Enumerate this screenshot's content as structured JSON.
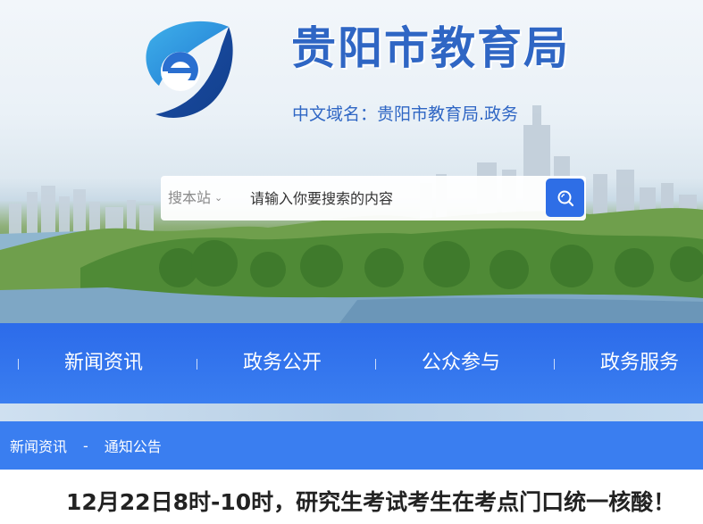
{
  "header": {
    "title": "贵阳市教育局",
    "domain_label": "中文域名：贵阳市教育局.政务",
    "logo_icon": "e-logo-icon"
  },
  "search": {
    "scope": "搜本站",
    "placeholder": "请输入你要搜索的内容",
    "button_icon": "search-icon"
  },
  "nav": {
    "items": [
      {
        "label": "新闻资讯"
      },
      {
        "label": "政务公开"
      },
      {
        "label": "公众参与"
      },
      {
        "label": "政务服务"
      }
    ]
  },
  "breadcrumb": {
    "items": [
      "新闻资讯",
      "通知公告"
    ],
    "separator": "-"
  },
  "article": {
    "title": "12月22日8时-10时，研究生考试考生在考点门口统一核酸！"
  },
  "colors": {
    "brand_blue": "#2f66c4",
    "nav_blue": "#2c6bea",
    "button_blue": "#2e6ee6"
  }
}
